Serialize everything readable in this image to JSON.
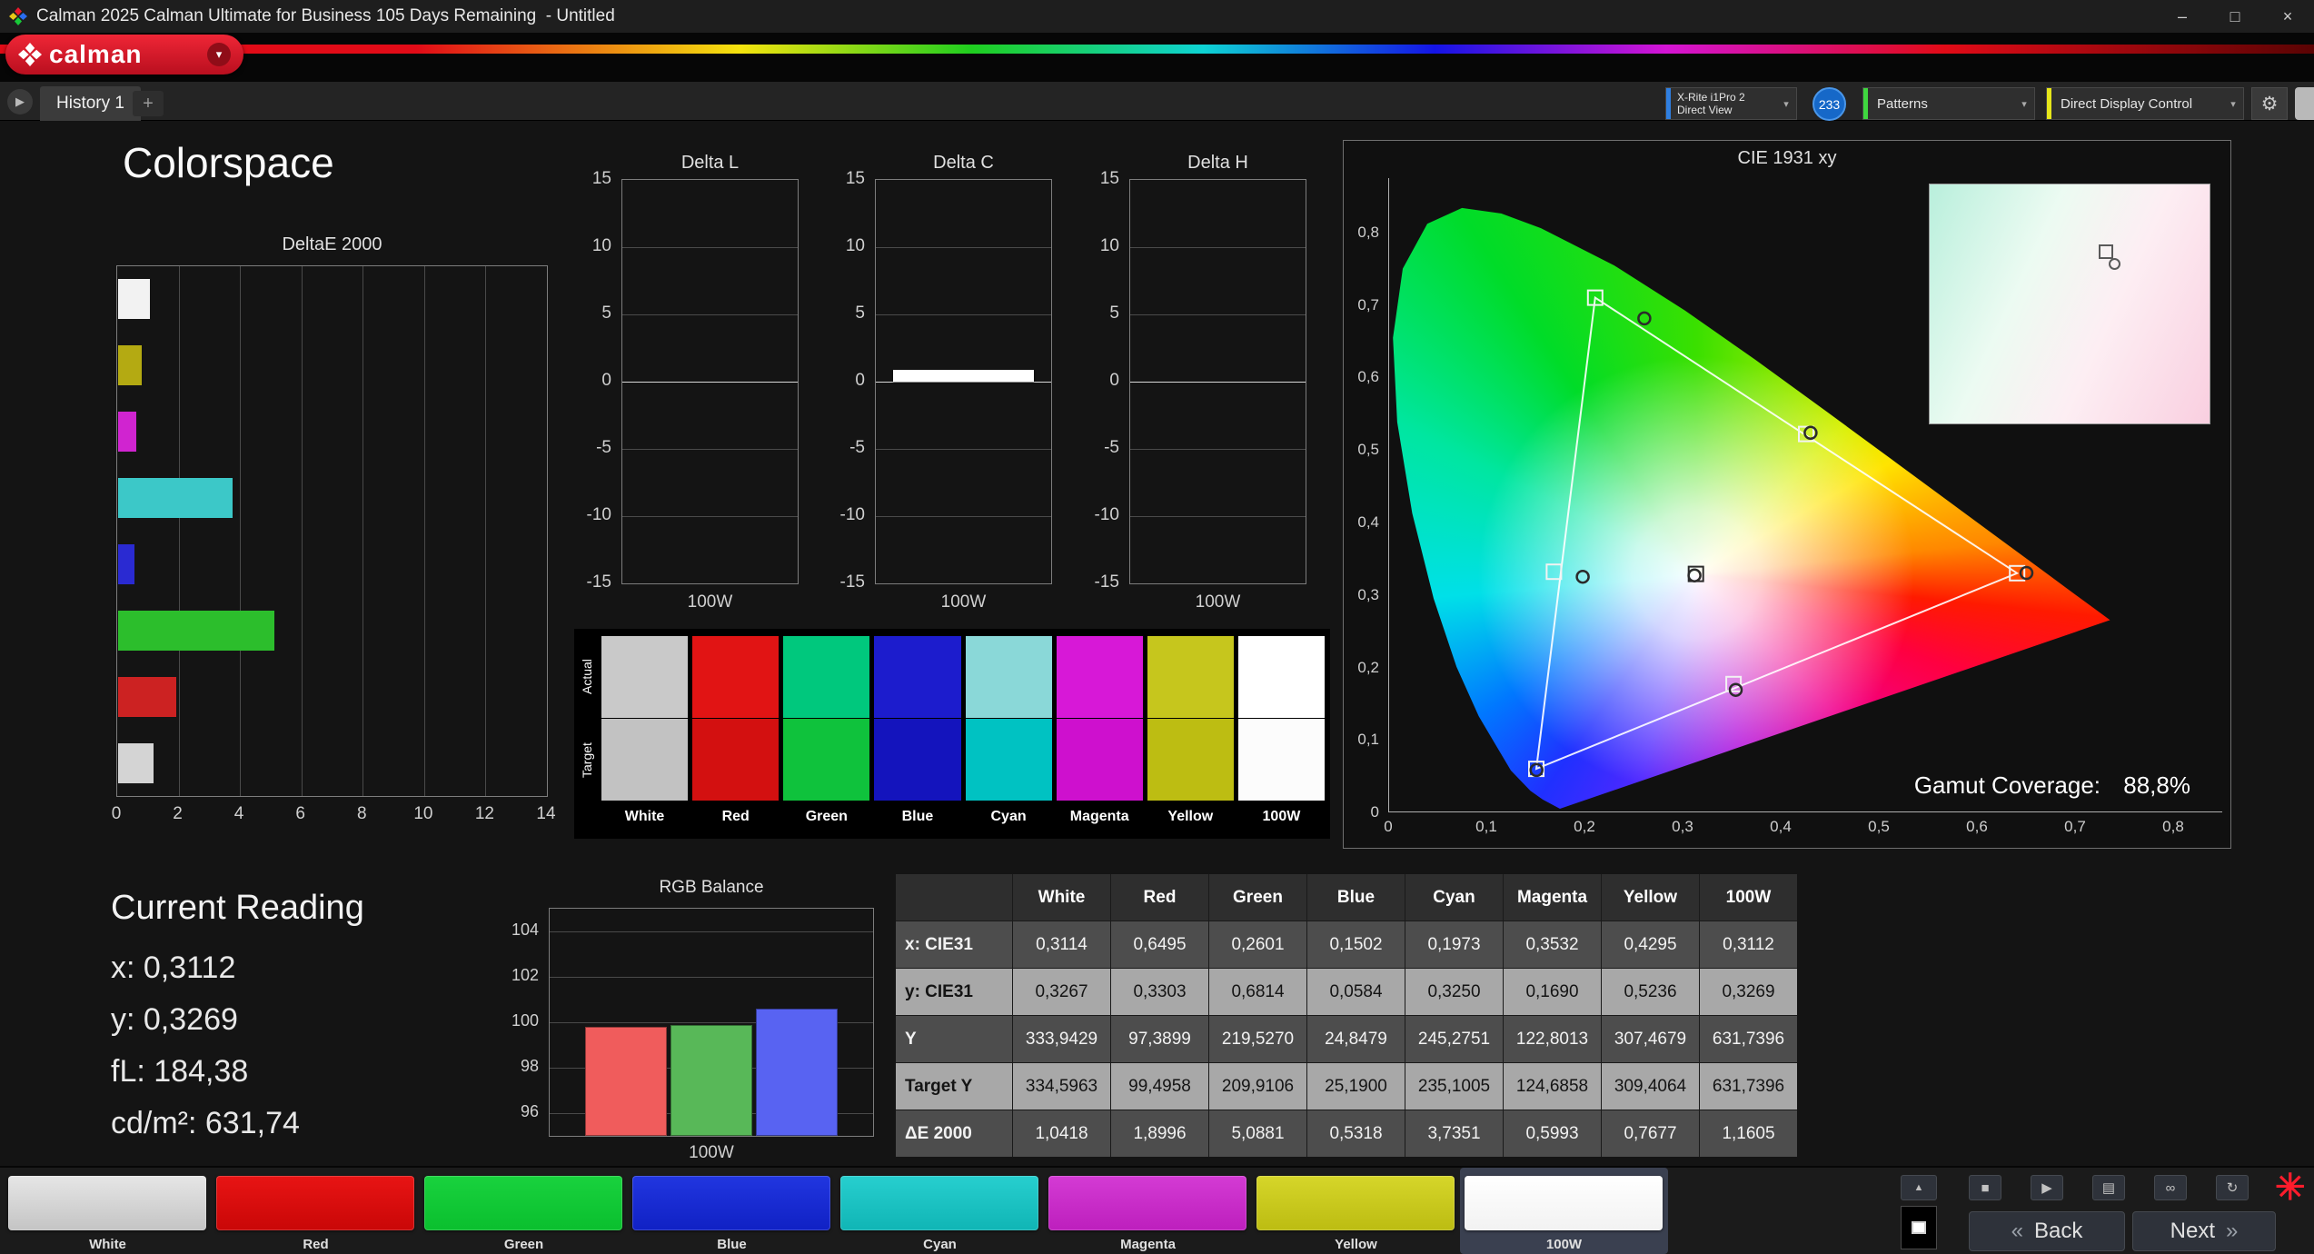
{
  "titlebar": {
    "title": "Calman 2025 Calman Ultimate for Business 105 Days Remaining  - Untitled",
    "minimize": "–",
    "maximize": "□",
    "close": "×"
  },
  "brand": {
    "logo_text": "calman",
    "dropdown_glyph": "▾"
  },
  "tabs": {
    "nav_glyph": "▶",
    "history_tab": "History 1",
    "add_tab": "+"
  },
  "toolbar": {
    "meter": {
      "line1": "X-Rite i1Pro 2",
      "line2": "Direct View",
      "badge": "233",
      "accent": "#2f7fe0"
    },
    "patterns": {
      "label": "Patterns",
      "accent": "#3fd63f"
    },
    "display_control": {
      "label": "Direct Display Control",
      "accent": "#e6e61a"
    },
    "gear_glyph": "⚙",
    "chevron_glyph": "▾"
  },
  "page_title": "Colorspace",
  "current_reading": {
    "title": "Current Reading",
    "lines": [
      "x: 0,3112",
      "y: 0,3269",
      "fL: 184,38",
      "cd/m²: 631,74"
    ]
  },
  "gamut_coverage": {
    "label": "Gamut Coverage:",
    "value": "88,8%"
  },
  "chart_data": [
    {
      "id": "deltae2000",
      "type": "bar",
      "orientation": "horizontal",
      "title": "DeltaE 2000",
      "categories": [
        "White",
        "Yellow",
        "Magenta",
        "Cyan",
        "Blue",
        "Green",
        "Red",
        "100W"
      ],
      "values": [
        1.0418,
        0.7677,
        0.5993,
        3.7351,
        0.5318,
        5.0881,
        1.8996,
        1.1605
      ],
      "bar_colors": [
        "#f2f2f2",
        "#b4aa12",
        "#d024d0",
        "#3cc8c8",
        "#2a2ad2",
        "#2cbe2c",
        "#cc2222",
        "#d4d4d4"
      ],
      "xlim": [
        0,
        14
      ],
      "xticks": [
        0,
        2,
        4,
        6,
        8,
        10,
        12,
        14
      ]
    },
    {
      "id": "delta_l",
      "type": "bar",
      "title": "Delta L",
      "categories": [
        "100W"
      ],
      "values": [
        0
      ],
      "ylim": [
        -15,
        15
      ],
      "yticks": [
        15,
        10,
        5,
        0,
        -5,
        -10,
        -15
      ],
      "xlabel": "100W"
    },
    {
      "id": "delta_c",
      "type": "bar",
      "title": "Delta C",
      "categories": [
        "100W"
      ],
      "values": [
        0.9
      ],
      "ylim": [
        -15,
        15
      ],
      "yticks": [
        15,
        10,
        5,
        0,
        -5,
        -10,
        -15
      ],
      "xlabel": "100W"
    },
    {
      "id": "delta_h",
      "type": "bar",
      "title": "Delta H",
      "categories": [
        "100W"
      ],
      "values": [
        0
      ],
      "ylim": [
        -15,
        15
      ],
      "yticks": [
        15,
        10,
        5,
        0,
        -5,
        -10,
        -15
      ],
      "xlabel": "100W"
    },
    {
      "id": "rgb_balance",
      "type": "bar",
      "title": "RGB Balance",
      "categories": [
        "Red",
        "Green",
        "Blue"
      ],
      "values": [
        99.8,
        99.9,
        100.6
      ],
      "bar_colors": [
        "#f05c5c",
        "#58b858",
        "#5863f2"
      ],
      "ylim": [
        95,
        105
      ],
      "yticks": [
        104,
        102,
        100,
        98,
        96
      ],
      "xlabel": "100W"
    },
    {
      "id": "cie1931",
      "type": "scatter",
      "title": "CIE 1931 xy",
      "xlim": [
        0,
        0.85
      ],
      "ylim": [
        0,
        0.875
      ],
      "xtick_labels": [
        "0",
        "0,1",
        "0,2",
        "0,3",
        "0,4",
        "0,5",
        "0,6",
        "0,7",
        "0,8"
      ],
      "ytick_labels": [
        "0",
        "0,1",
        "0,2",
        "0,3",
        "0,4",
        "0,5",
        "0,6",
        "0,7",
        "0,8"
      ],
      "target_triangle": {
        "red": [
          0.64,
          0.33
        ],
        "green": [
          0.21,
          0.71
        ],
        "blue": [
          0.15,
          0.06
        ]
      },
      "target_points": {
        "white": [
          0.3127,
          0.329
        ],
        "red": [
          0.64,
          0.33
        ],
        "green": [
          0.21,
          0.71
        ],
        "blue": [
          0.15,
          0.06
        ],
        "cyan": [
          0.168,
          0.332
        ],
        "magenta": [
          0.351,
          0.177
        ],
        "yellow": [
          0.425,
          0.522
        ]
      },
      "measured_points": {
        "white": [
          0.3112,
          0.3269
        ],
        "red": [
          0.6495,
          0.3303
        ],
        "green": [
          0.2601,
          0.6814
        ],
        "blue": [
          0.1502,
          0.0584
        ],
        "cyan": [
          0.1973,
          0.325
        ],
        "magenta": [
          0.3532,
          0.169
        ],
        "yellow": [
          0.4295,
          0.5236
        ]
      },
      "spectral_locus": [
        [
          0.1741,
          0.005
        ],
        [
          0.1566,
          0.0177
        ],
        [
          0.144,
          0.0297
        ],
        [
          0.1241,
          0.0578
        ],
        [
          0.0913,
          0.1327
        ],
        [
          0.0687,
          0.2007
        ],
        [
          0.0454,
          0.295
        ],
        [
          0.0235,
          0.4127
        ],
        [
          0.0082,
          0.5384
        ],
        [
          0.0039,
          0.6548
        ],
        [
          0.0139,
          0.7502
        ],
        [
          0.0389,
          0.812
        ],
        [
          0.0743,
          0.8338
        ],
        [
          0.1142,
          0.8262
        ],
        [
          0.1547,
          0.8059
        ],
        [
          0.2296,
          0.7543
        ],
        [
          0.3016,
          0.6923
        ],
        [
          0.3731,
          0.6245
        ],
        [
          0.4441,
          0.5547
        ],
        [
          0.5125,
          0.4866
        ],
        [
          0.5752,
          0.4242
        ],
        [
          0.627,
          0.3725
        ],
        [
          0.6658,
          0.334
        ],
        [
          0.6915,
          0.3083
        ],
        [
          0.719,
          0.2809
        ],
        [
          0.7347,
          0.2653
        ]
      ]
    }
  ],
  "swatch_compare": {
    "row_labels": [
      "Actual",
      "Target"
    ],
    "columns": [
      {
        "name": "White",
        "actual": "#c9c9c9",
        "target": "#c2c2c2"
      },
      {
        "name": "Red",
        "actual": "#e11414",
        "target": "#d31010"
      },
      {
        "name": "Green",
        "actual": "#00c87d",
        "target": "#0fc23c"
      },
      {
        "name": "Blue",
        "actual": "#1c1ccd",
        "target": "#1414bd"
      },
      {
        "name": "Cyan",
        "actual": "#8ad8d8",
        "target": "#00c2c2"
      },
      {
        "name": "Magenta",
        "actual": "#d718d7",
        "target": "#ce10ce"
      },
      {
        "name": "Yellow",
        "actual": "#c6c61d",
        "target": "#bdbd12"
      },
      {
        "name": "100W",
        "actual": "#ffffff",
        "target": "#fcfcfc"
      }
    ]
  },
  "table": {
    "header": [
      "White",
      "Red",
      "Green",
      "Blue",
      "Cyan",
      "Magenta",
      "Yellow",
      "100W"
    ],
    "rows": [
      {
        "label": "x: CIE31",
        "values": [
          "0,3114",
          "0,6495",
          "0,2601",
          "0,1502",
          "0,1973",
          "0,3532",
          "0,4295",
          "0,3112"
        ]
      },
      {
        "label": "y: CIE31",
        "values": [
          "0,3267",
          "0,3303",
          "0,6814",
          "0,0584",
          "0,3250",
          "0,1690",
          "0,5236",
          "0,3269"
        ]
      },
      {
        "label": "Y",
        "values": [
          "333,9429",
          "97,3899",
          "219,5270",
          "24,8479",
          "245,2751",
          "122,8013",
          "307,4679",
          "631,7396"
        ]
      },
      {
        "label": "Target Y",
        "values": [
          "334,5963",
          "99,4958",
          "209,9106",
          "25,1900",
          "235,1005",
          "124,6858",
          "309,4064",
          "631,7396"
        ]
      },
      {
        "label": "ΔE 2000",
        "values": [
          "1,0418",
          "1,8996",
          "5,0881",
          "0,5318",
          "3,7351",
          "0,5993",
          "0,7677",
          "1,1605"
        ]
      }
    ]
  },
  "pattern_bar": {
    "buttons": [
      {
        "label": "White",
        "color_top": "#e6e6e6",
        "color_bottom": "#c4c4c4",
        "selected": false
      },
      {
        "label": "Red",
        "color_top": "#e81414",
        "color_bottom": "#c90707",
        "selected": false
      },
      {
        "label": "Green",
        "color_top": "#19d23e",
        "color_bottom": "#0abf2e",
        "selected": false
      },
      {
        "label": "Blue",
        "color_top": "#2136e0",
        "color_bottom": "#1021c4",
        "selected": false
      },
      {
        "label": "Cyan",
        "color_top": "#27cfcf",
        "color_bottom": "#10b5b5",
        "selected": false
      },
      {
        "label": "Magenta",
        "color_top": "#d43bd4",
        "color_bottom": "#bd1fbd",
        "selected": false
      },
      {
        "label": "Yellow",
        "color_top": "#d6d62a",
        "color_bottom": "#bcbc12",
        "selected": false
      },
      {
        "label": "100W",
        "color_top": "#ffffff",
        "color_bottom": "#f2f2f2",
        "selected": true
      }
    ]
  },
  "transport": {
    "collapse_glyph": "▲",
    "buttons": [
      {
        "name": "stop",
        "glyph": "■"
      },
      {
        "name": "play",
        "glyph": "▶"
      },
      {
        "name": "save",
        "glyph": "▤"
      },
      {
        "name": "link",
        "glyph": "∞"
      },
      {
        "name": "refresh",
        "glyph": "↻"
      }
    ],
    "back_glyph": "«",
    "back_label": "Back",
    "next_label": "Next",
    "next_glyph": "»",
    "asterisk_glyph": "✳"
  }
}
